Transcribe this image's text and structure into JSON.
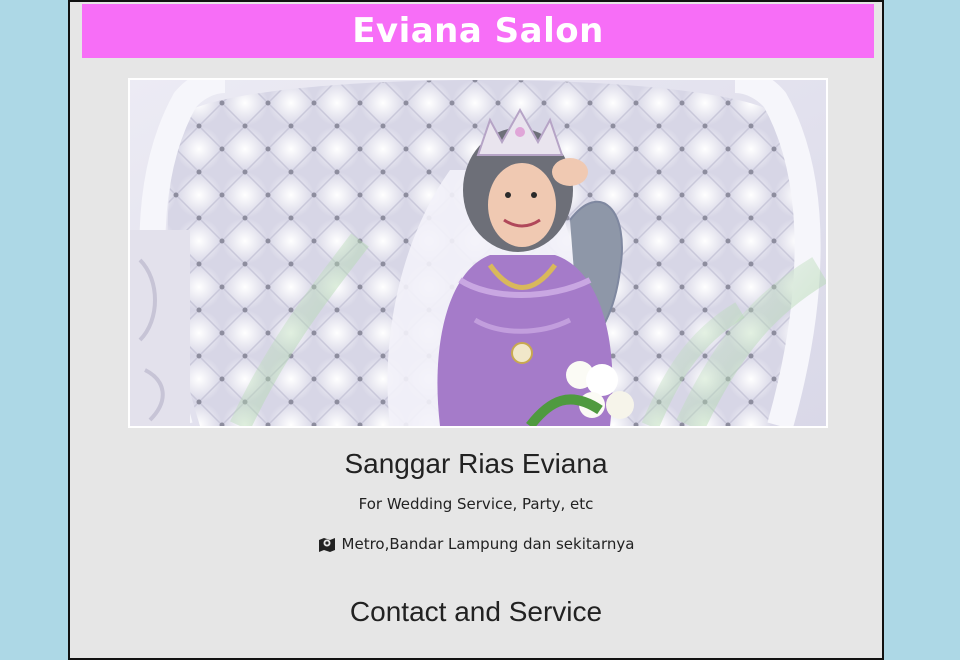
{
  "header": {
    "brand": "Eviana Salon"
  },
  "hero": {
    "image_alt": "Bride in purple kebaya seated on white tufted throne"
  },
  "studio": {
    "name": "Sanggar Rias Eviana",
    "tagline": "For Wedding Service, Party, etc",
    "location_icon": "map-marker-icon",
    "location": "Metro,Bandar Lampung dan sekitarnya"
  },
  "sections": {
    "contact_title": "Contact and Service"
  },
  "colors": {
    "page_background": "#add8e6",
    "content_background": "#e6e6e6",
    "header_bar": "#f76ef7",
    "brand_text": "#ffffff"
  }
}
